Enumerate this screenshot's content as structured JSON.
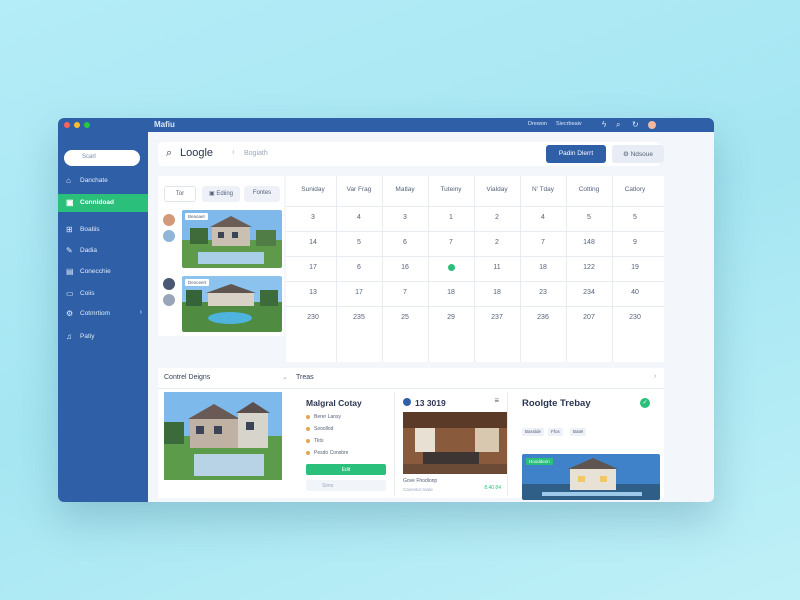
{
  "app": {
    "title": "Mafiu"
  },
  "titlebar": {
    "links": [
      "Drewon",
      "Siecrbeaiv"
    ],
    "icons": [
      "lightning-icon",
      "search-icon",
      "refresh-icon",
      "avatar"
    ]
  },
  "sidebar": {
    "search_placeholder": "Scarl",
    "items": [
      {
        "label": "Danchate",
        "icon": "home-icon",
        "active": false
      },
      {
        "label": "Connidoad",
        "icon": "dashboard-icon",
        "active": true
      },
      {
        "label": "Boatiis",
        "icon": "grid-icon",
        "active": false
      },
      {
        "label": "Dadia",
        "icon": "pencil-icon",
        "active": false
      },
      {
        "label": "Conecchie",
        "icon": "building-icon",
        "active": false
      },
      {
        "label": "Coiis",
        "icon": "folder-icon",
        "active": false
      },
      {
        "label": "Cotmrtiom",
        "icon": "settings-icon",
        "active": false
      },
      {
        "label": "Patiy",
        "icon": "chart-icon",
        "active": false
      }
    ]
  },
  "topbar": {
    "search_query": "Loogle",
    "separator": "›",
    "hint": "Bogiath",
    "primary_button": "Padin Dlerrt",
    "secondary_button": "Ndsoue"
  },
  "left_panel": {
    "tabs": [
      "Tor",
      "Ediing",
      "Fontes"
    ],
    "listings": [
      {
        "badge": "Beaoaet"
      },
      {
        "badge": "Deoceert"
      }
    ]
  },
  "calendar": {
    "headers": [
      "Suniday",
      "Var Frag",
      "Matlay",
      "Tuteiny",
      "Vialday",
      "N' Tday",
      "Cotting",
      "Catlory"
    ],
    "rows": [
      [
        "3",
        "4",
        "3",
        "1",
        "2",
        "4",
        "5",
        "5"
      ],
      [
        "14",
        "5",
        "6",
        "7",
        "2",
        "7",
        "148",
        "9"
      ],
      [
        "17",
        "6",
        "16",
        "",
        "11",
        "18",
        "122",
        "19"
      ],
      [
        "13",
        "17",
        "7",
        "18",
        "18",
        "23",
        "234",
        "40"
      ],
      [
        "230",
        "235",
        "25",
        "29",
        "237",
        "236",
        "207",
        "230"
      ]
    ]
  },
  "bottom": {
    "sections": {
      "left_title": "Contrel Deigns",
      "right_title": "Treas"
    },
    "card_checklist": {
      "title": "Malgral Cotay",
      "items": [
        "Berer Lansy",
        "Sooollod",
        "Tkts",
        "Pesdo Consbre"
      ],
      "button": "Edit",
      "input_placeholder": "Simo"
    },
    "card_interior": {
      "date": "13 3019",
      "caption": "Gove Fhodionp",
      "subcaption": "Casnetor tcwle",
      "stat": "8.40 84"
    },
    "card_today": {
      "title": "Roolgte Trebay",
      "tags": [
        "Basslde",
        "Ffos",
        "Batel"
      ],
      "image_badge": "Hooddeon"
    }
  },
  "colors": {
    "brand": "#2f5fa6",
    "accent_green": "#2ac07b",
    "background": "#a9e7f3"
  }
}
